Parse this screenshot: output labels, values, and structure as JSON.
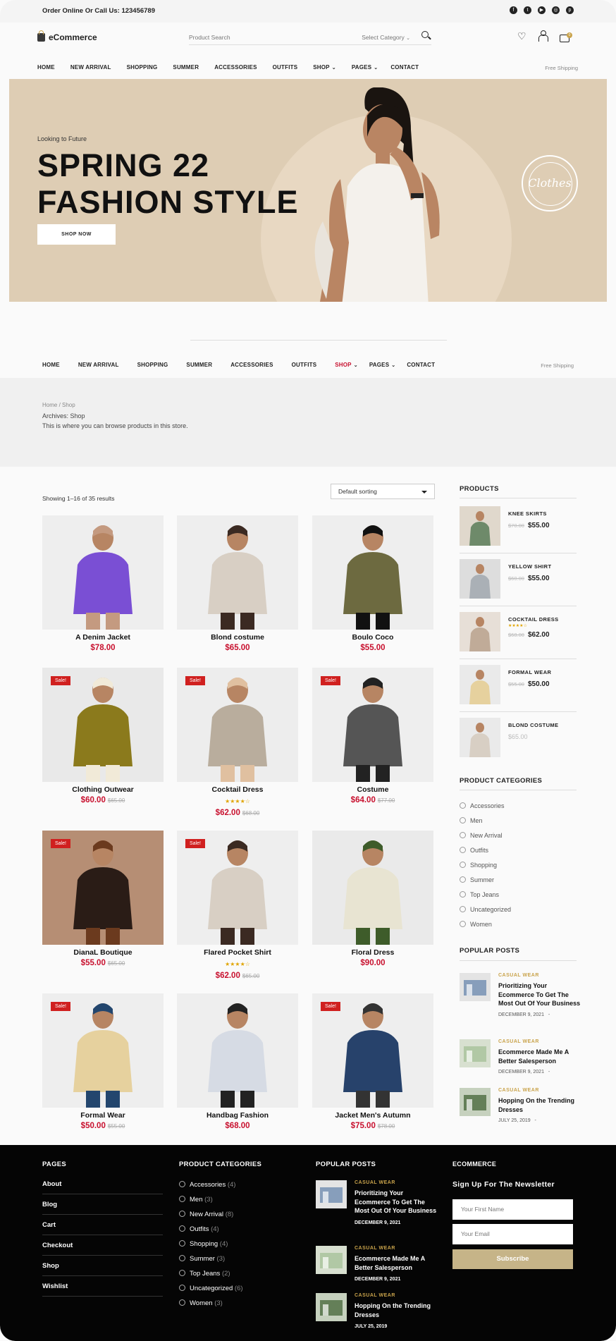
{
  "topbar": {
    "contact": "Order Online Or Call Us: 123456789",
    "social_icons": [
      "facebook-icon",
      "twitter-icon",
      "youtube-icon",
      "instagram-icon",
      "pinterest-icon"
    ]
  },
  "header": {
    "logo": "eCommerce",
    "search_placeholder": "Product Search",
    "category_select": "Select Category",
    "cart_count": "0"
  },
  "nav": {
    "items": [
      "HOME",
      "NEW ARRIVAL",
      "SHOPPING",
      "SUMMER",
      "ACCESSORIES",
      "OUTFITS",
      "SHOP",
      "PAGES",
      "CONTACT"
    ],
    "free_shipping": "Free Shipping",
    "active": "SHOP"
  },
  "hero": {
    "tagline": "Looking to Future",
    "title_line1": "SPRING 22",
    "title_line2": "FASHION STYLE",
    "button": "SHOP NOW",
    "stamp": "Clothes"
  },
  "archive": {
    "breadcrumb": "Home / Shop",
    "title": "Archives: Shop",
    "description": "This is where you can browse products in this store."
  },
  "shop": {
    "result_count": "Showing 1–16 of 35 results",
    "sorting": "Default sorting",
    "sale_label": "Sale!",
    "products": [
      {
        "name": "A Denim Jacket",
        "price": "$78.00",
        "old_price": "",
        "sale": false,
        "rating": ""
      },
      {
        "name": "Blond costume",
        "price": "$65.00",
        "old_price": "",
        "sale": false,
        "rating": ""
      },
      {
        "name": "Boulo Coco",
        "price": "$55.00",
        "old_price": "",
        "sale": false,
        "rating": ""
      },
      {
        "name": "Clothing Outwear",
        "price": "$60.00",
        "old_price": "$65.00",
        "sale": true,
        "rating": ""
      },
      {
        "name": "Cocktail Dress",
        "price": "$62.00",
        "old_price": "$68.00",
        "sale": true,
        "rating": "★★★★☆"
      },
      {
        "name": "Costume",
        "price": "$64.00",
        "old_price": "$77.00",
        "sale": true,
        "rating": ""
      },
      {
        "name": "DianaL Boutique",
        "price": "$55.00",
        "old_price": "$65.00",
        "sale": true,
        "rating": ""
      },
      {
        "name": "Flared Pocket Shirt",
        "price": "$62.00",
        "old_price": "$65.00",
        "sale": true,
        "rating": "★★★★☆"
      },
      {
        "name": "Floral Dress",
        "price": "$90.00",
        "old_price": "",
        "sale": false,
        "rating": ""
      },
      {
        "name": "Formal Wear",
        "price": "$50.00",
        "old_price": "$55.00",
        "sale": true,
        "rating": ""
      },
      {
        "name": "Handbag Fashion",
        "price": "$68.00",
        "old_price": "",
        "sale": false,
        "rating": ""
      },
      {
        "name": "Jacket Men's Autumn",
        "price": "$75.00",
        "old_price": "$78.00",
        "sale": true,
        "rating": ""
      }
    ]
  },
  "sidebar": {
    "products_title": "PRODUCTS",
    "products": [
      {
        "name": "KNEE SKIRTS",
        "old_price": "$70.00",
        "price": "$55.00",
        "rating": ""
      },
      {
        "name": "YELLOW SHIRT",
        "old_price": "$60.00",
        "price": "$55.00",
        "rating": ""
      },
      {
        "name": "COCKTAIL DRESS",
        "old_price": "$68.00",
        "price": "$62.00",
        "rating": "★★★★☆"
      },
      {
        "name": "FORMAL WEAR",
        "old_price": "$55.00",
        "price": "$50.00",
        "rating": ""
      },
      {
        "name": "BLOND COSTUME",
        "old_price": "",
        "price": "$65.00",
        "rating": ""
      }
    ],
    "categories_title": "PRODUCT CATEGORIES",
    "categories": [
      "Accessories",
      "Men",
      "New Arrival",
      "Outfits",
      "Shopping",
      "Summer",
      "Top Jeans",
      "Uncategorized",
      "Women"
    ],
    "posts_title": "POPULAR POSTS",
    "posts": [
      {
        "category": "CASUAL WEAR",
        "title": "Prioritizing Your Ecommerce To Get The Most Out Of Your Business",
        "date": "DECEMBER 9, 2021",
        "sep": "-"
      },
      {
        "category": "CASUAL WEAR",
        "title": "Ecommerce Made Me A Better Salesperson",
        "date": "DECEMBER 9, 2021",
        "sep": "-"
      },
      {
        "category": "CASUAL WEAR",
        "title": "Hopping On the Trending Dresses",
        "date": "JULY 25, 2019",
        "sep": "-"
      }
    ]
  },
  "footer": {
    "pages_title": "PAGES",
    "pages": [
      "About",
      "Blog",
      "Cart",
      "Checkout",
      "Shop",
      "Wishlist"
    ],
    "categories_title": "PRODUCT CATEGORIES",
    "categories": [
      {
        "name": "Accessories",
        "count": "(4)"
      },
      {
        "name": "Men",
        "count": "(3)"
      },
      {
        "name": "New Arrival",
        "count": "(8)"
      },
      {
        "name": "Outfits",
        "count": "(4)"
      },
      {
        "name": "Shopping",
        "count": "(4)"
      },
      {
        "name": "Summer",
        "count": "(3)"
      },
      {
        "name": "Top Jeans",
        "count": "(2)"
      },
      {
        "name": "Uncategorized",
        "count": "(6)"
      },
      {
        "name": "Women",
        "count": "(3)"
      }
    ],
    "posts_title": "POPULAR POSTS",
    "posts": [
      {
        "category": "CASUAL WEAR",
        "title": "Prioritizing Your Ecommerce To Get The Most Out Of Your Business",
        "date": "DECEMBER 9, 2021"
      },
      {
        "category": "CASUAL WEAR",
        "title": "Ecommerce Made Me A Better Salesperson",
        "date": "DECEMBER 9, 2021"
      },
      {
        "category": "CASUAL WEAR",
        "title": "Hopping On the Trending Dresses",
        "date": "JULY 25, 2019"
      }
    ],
    "brand_title": "ECOMMERCE",
    "newsletter_title": "Sign Up For The Newsletter",
    "first_name_placeholder": "Your First Name",
    "email_placeholder": "Your Email",
    "subscribe": "Subscribe"
  },
  "colors": {
    "accent": "#c9a34b",
    "price": "#c8102e",
    "sale": "#d0201f",
    "hero_bg": "#decdb4",
    "footer_bg": "#050505",
    "subscribe": "#c6b488"
  }
}
